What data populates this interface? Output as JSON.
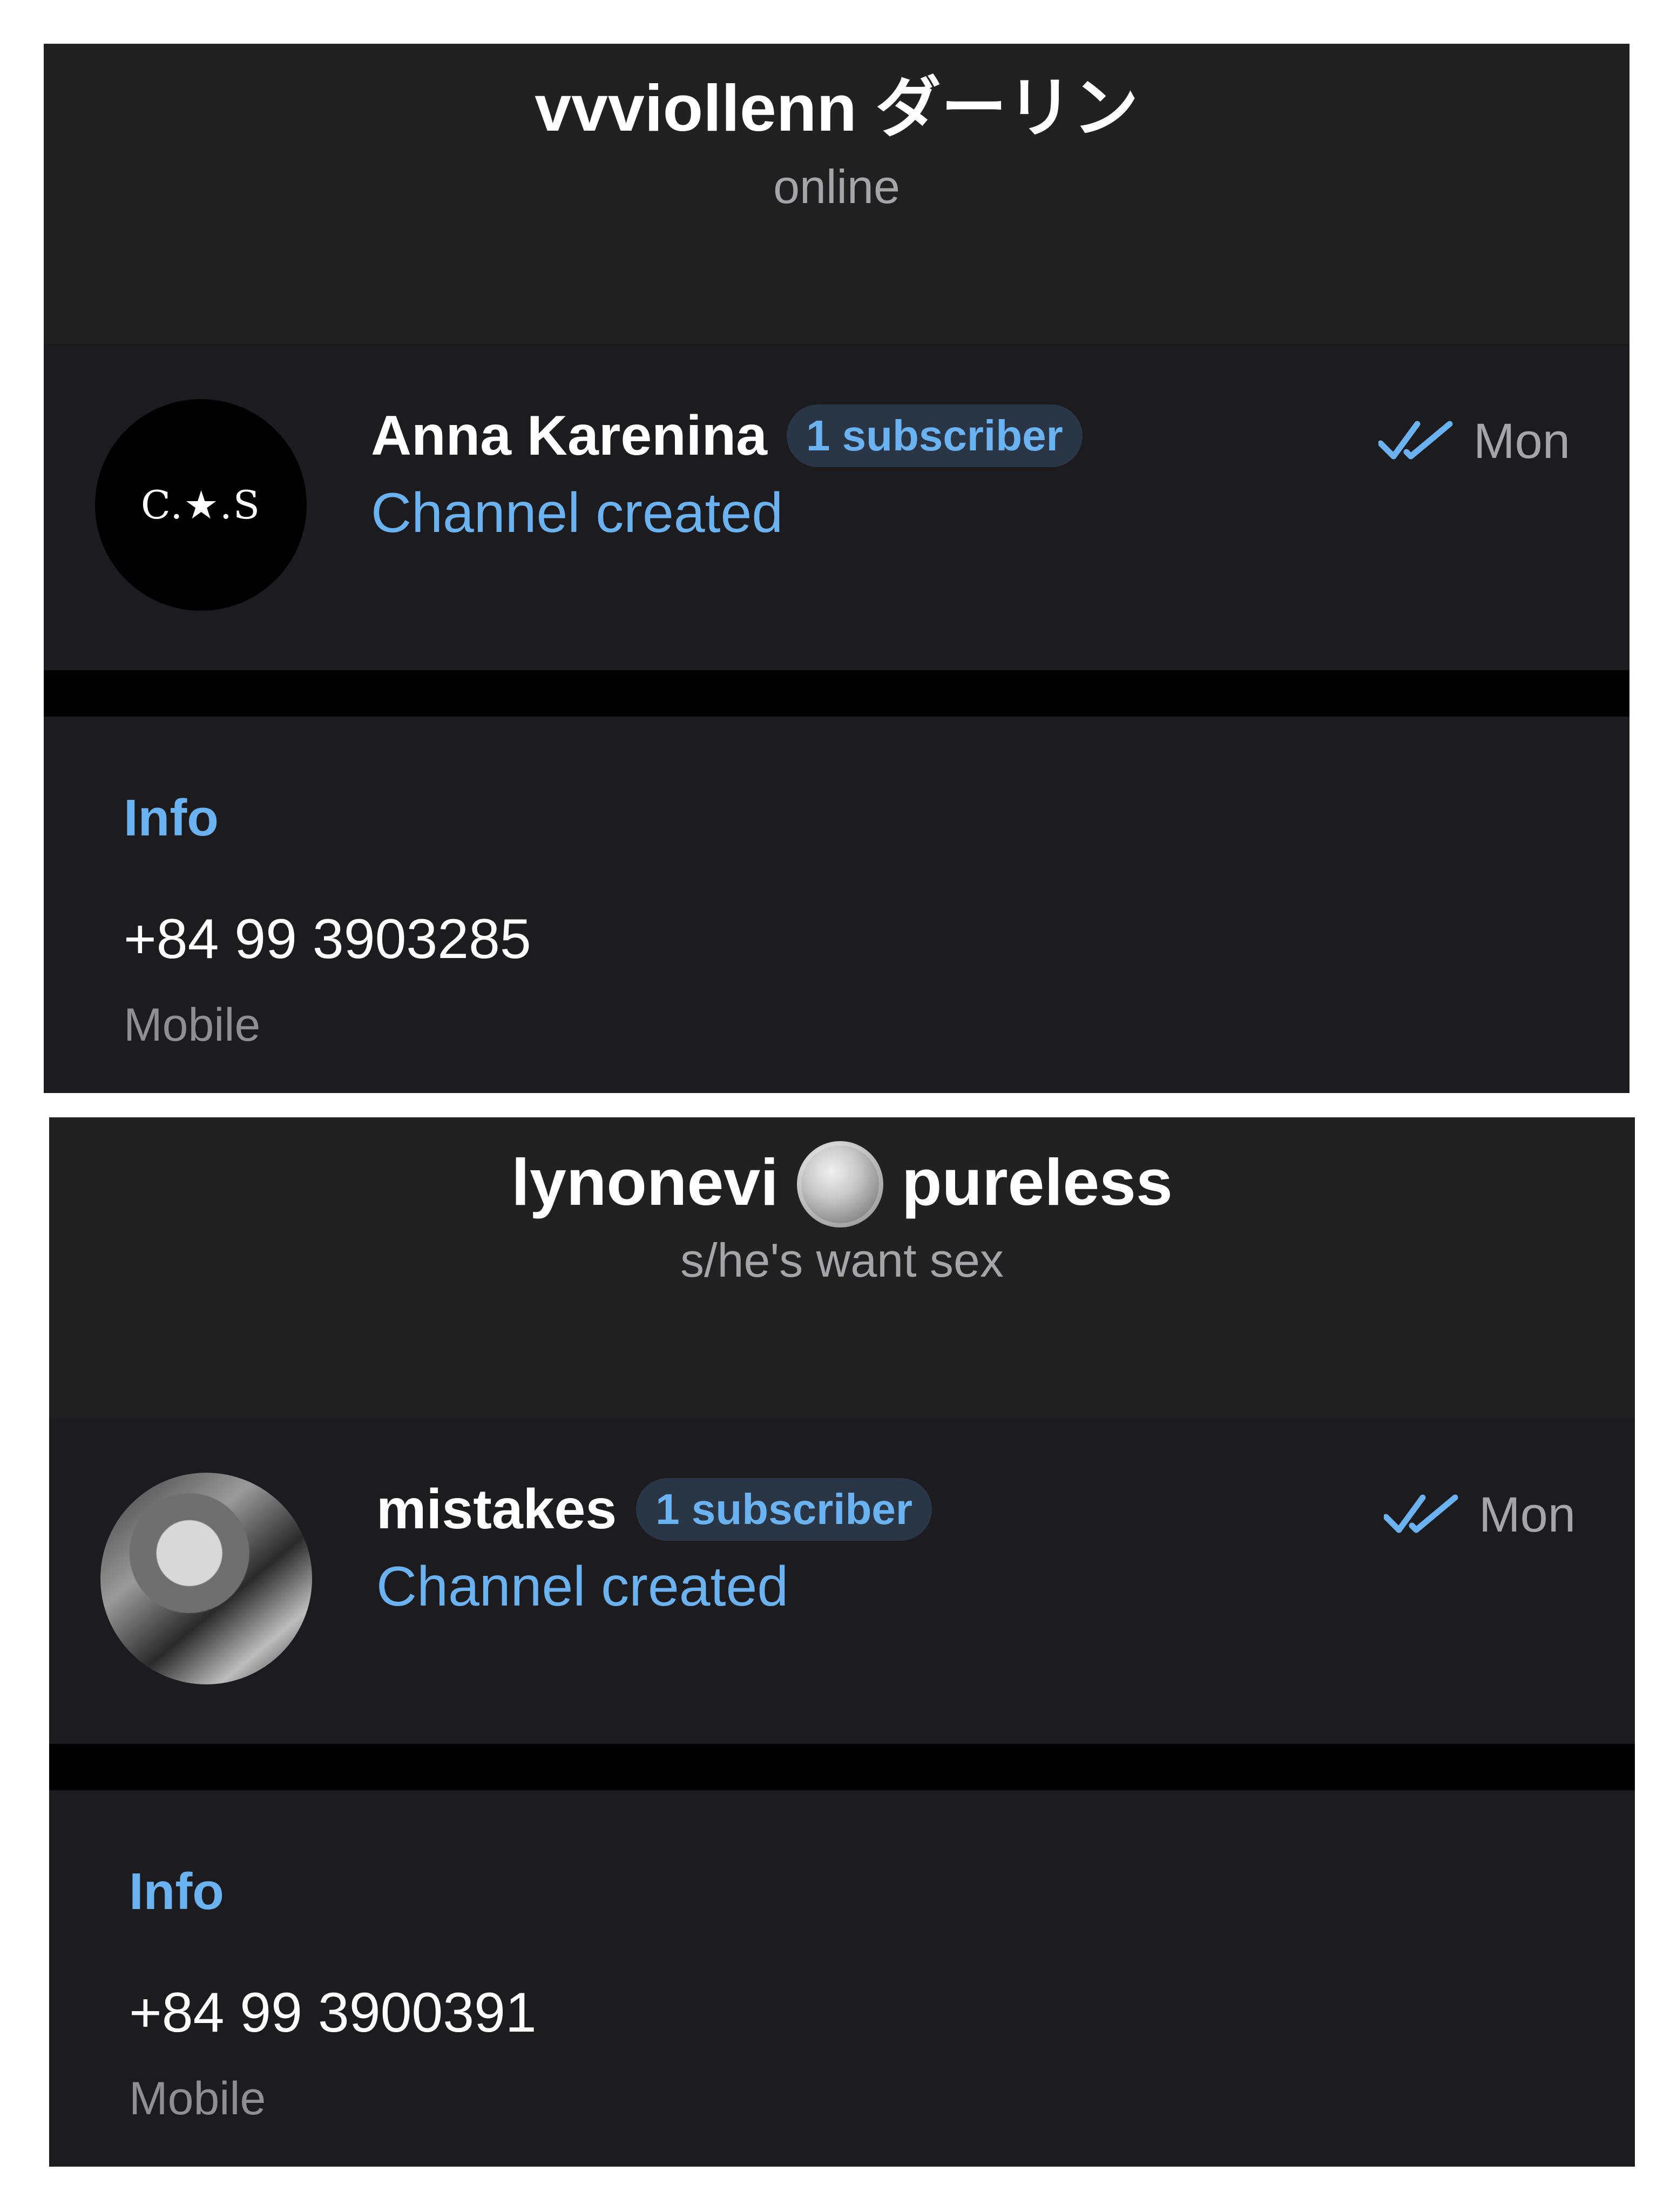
{
  "accent": "#6ab2f2",
  "panels": [
    {
      "header": {
        "title_left": "vvviollenn ダーリン",
        "title_right": "",
        "status": "online",
        "emoji": ""
      },
      "chat": {
        "avatar_text": "C.★.S",
        "name": "Anna Karenina",
        "badge": "1 subscriber",
        "preview": "Channel created",
        "time": "Mon",
        "check_icon": "double-check-icon"
      },
      "info": {
        "header": "Info",
        "phone": "+84 99 3903285",
        "phone_label": "Mobile"
      }
    },
    {
      "header": {
        "title_left": "lynonevi",
        "title_right": "pureless",
        "status": "s/he's want sex",
        "emoji": "coin-icon"
      },
      "chat": {
        "avatar_text": "",
        "name": "mistakes",
        "badge": "1 subscriber",
        "preview": "Channel created",
        "time": "Mon",
        "check_icon": "double-check-icon"
      },
      "info": {
        "header": "Info",
        "phone": "+84 99 3900391",
        "phone_label": "Mobile"
      }
    }
  ]
}
